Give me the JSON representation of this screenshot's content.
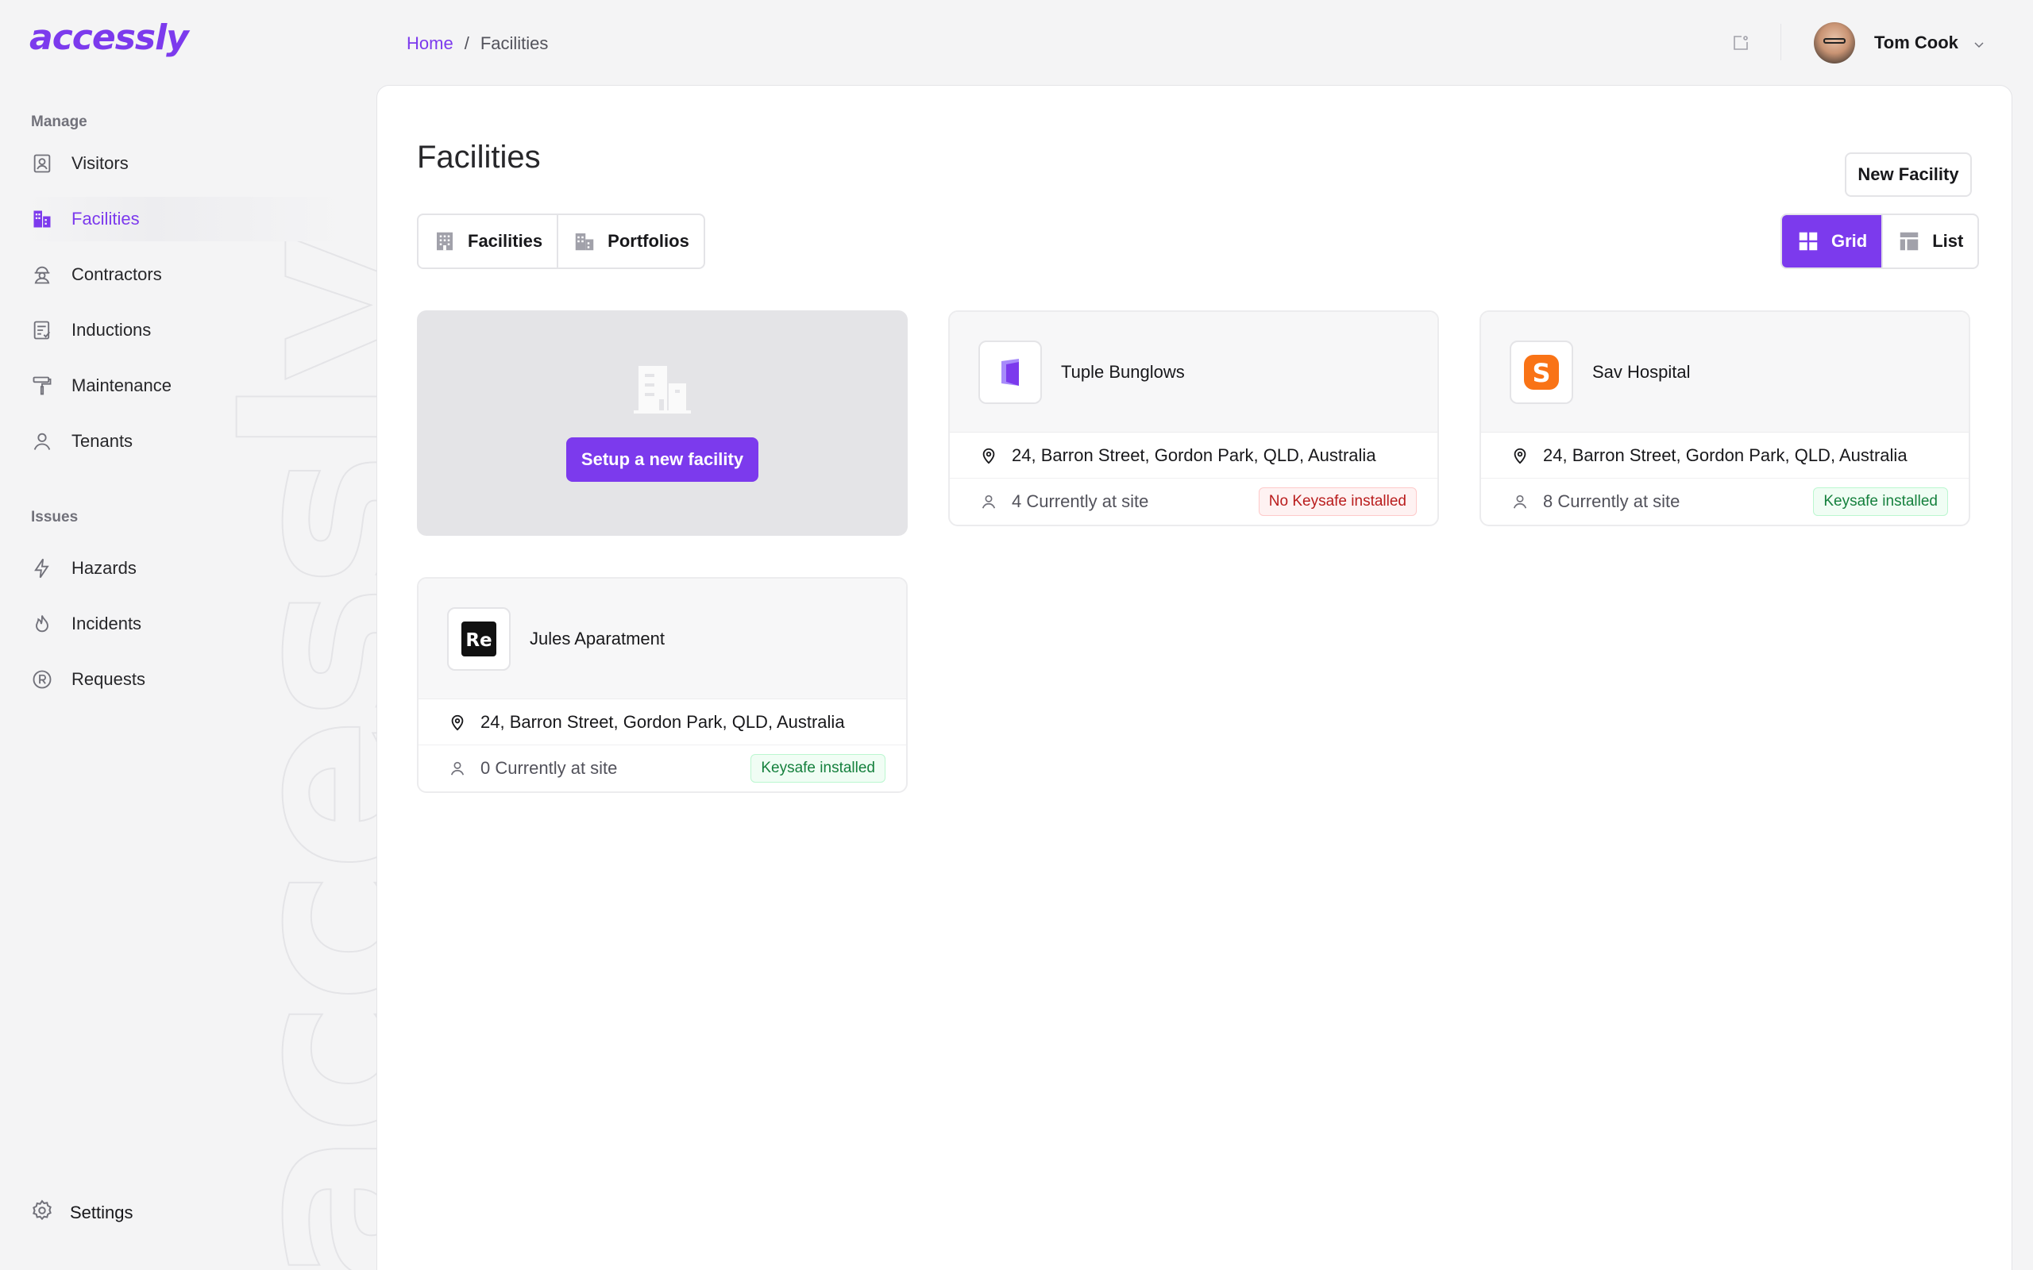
{
  "brand": {
    "logo_text": "accessly",
    "accent": "#7c3aed"
  },
  "sidebar": {
    "sections": [
      {
        "label": "Manage"
      },
      {
        "label": "Issues"
      }
    ],
    "items": [
      {
        "label": "Visitors",
        "icon": "visitor-badge-icon"
      },
      {
        "label": "Facilities",
        "icon": "building-icon",
        "active": true
      },
      {
        "label": "Contractors",
        "icon": "hardhat-icon"
      },
      {
        "label": "Inductions",
        "icon": "checklist-icon"
      },
      {
        "label": "Maintenance",
        "icon": "paint-roller-icon"
      },
      {
        "label": "Tenants",
        "icon": "user-icon"
      },
      {
        "label": "Hazards",
        "icon": "lightning-icon"
      },
      {
        "label": "Incidents",
        "icon": "flame-icon"
      },
      {
        "label": "Requests",
        "icon": "registered-icon"
      }
    ],
    "settings_label": "Settings"
  },
  "breadcrumb": {
    "home": "Home",
    "separator": "/",
    "current": "Facilities"
  },
  "user": {
    "name": "Tom Cook"
  },
  "page": {
    "title": "Facilities",
    "new_button": "New Facility",
    "tabs": [
      {
        "label": "Facilities",
        "icon": "building-icon"
      },
      {
        "label": "Portfolios",
        "icon": "buildings-icon"
      }
    ],
    "view_toggle": [
      {
        "label": "Grid",
        "icon": "grid-icon",
        "selected": true
      },
      {
        "label": "List",
        "icon": "table-icon",
        "selected": false
      }
    ],
    "setup_button": "Setup a new facility"
  },
  "facilities": [
    {
      "name": "Tuple Bunglows",
      "address": "24, Barron Street, Gordon Park, QLD, Australia",
      "count": "4 Currently at site",
      "badge": "No Keysafe installed",
      "badge_status": "bad"
    },
    {
      "name": "Sav Hospital",
      "address": "24, Barron Street, Gordon Park, QLD, Australia",
      "count": "8 Currently at site",
      "badge": "Keysafe installed",
      "badge_status": "good"
    },
    {
      "name": "Jules Aparatment",
      "address": "24, Barron Street, Gordon Park, QLD, Australia",
      "count": "0 Currently at site",
      "badge": "Keysafe installed",
      "badge_status": "good"
    }
  ]
}
